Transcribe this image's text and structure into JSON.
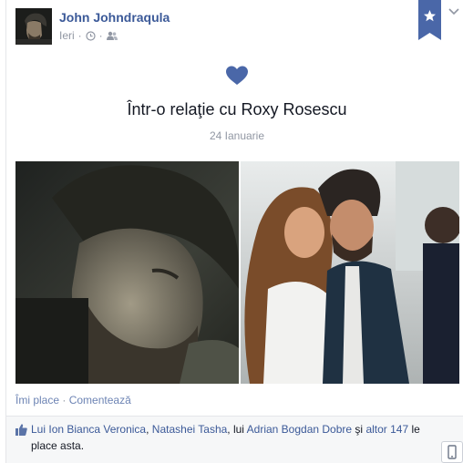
{
  "post": {
    "author": "John Johndraqula",
    "time": "Ieri",
    "meta_sep": "·"
  },
  "relationship": {
    "title": "Într-o relaţie cu Roxy Rosescu",
    "date": "24 Ianuarie"
  },
  "actions": {
    "like": "Îmi place",
    "sep": "·",
    "comment": "Comentează"
  },
  "likes": {
    "prefix": "Lui",
    "person1": "Ion Bianca Veronica",
    "comma1": ",",
    "person2": "Natashei Tasha",
    "comma2": ", lui",
    "person3": "Adrian Bogdan Dobre",
    "and": "şi",
    "others": "altor 147",
    "suffix": "le place asta."
  },
  "icons": {
    "bookmark": "star-bookmark-icon",
    "chevron": "chevron-down-icon",
    "heart": "heart-icon",
    "clock": "clock-icon",
    "audience": "friends-icon",
    "like": "thumbs-up-icon",
    "mobile": "mobile-icon"
  },
  "colors": {
    "link": "#3b5998",
    "accent": "#4a67a8",
    "muted": "#9197a3"
  }
}
